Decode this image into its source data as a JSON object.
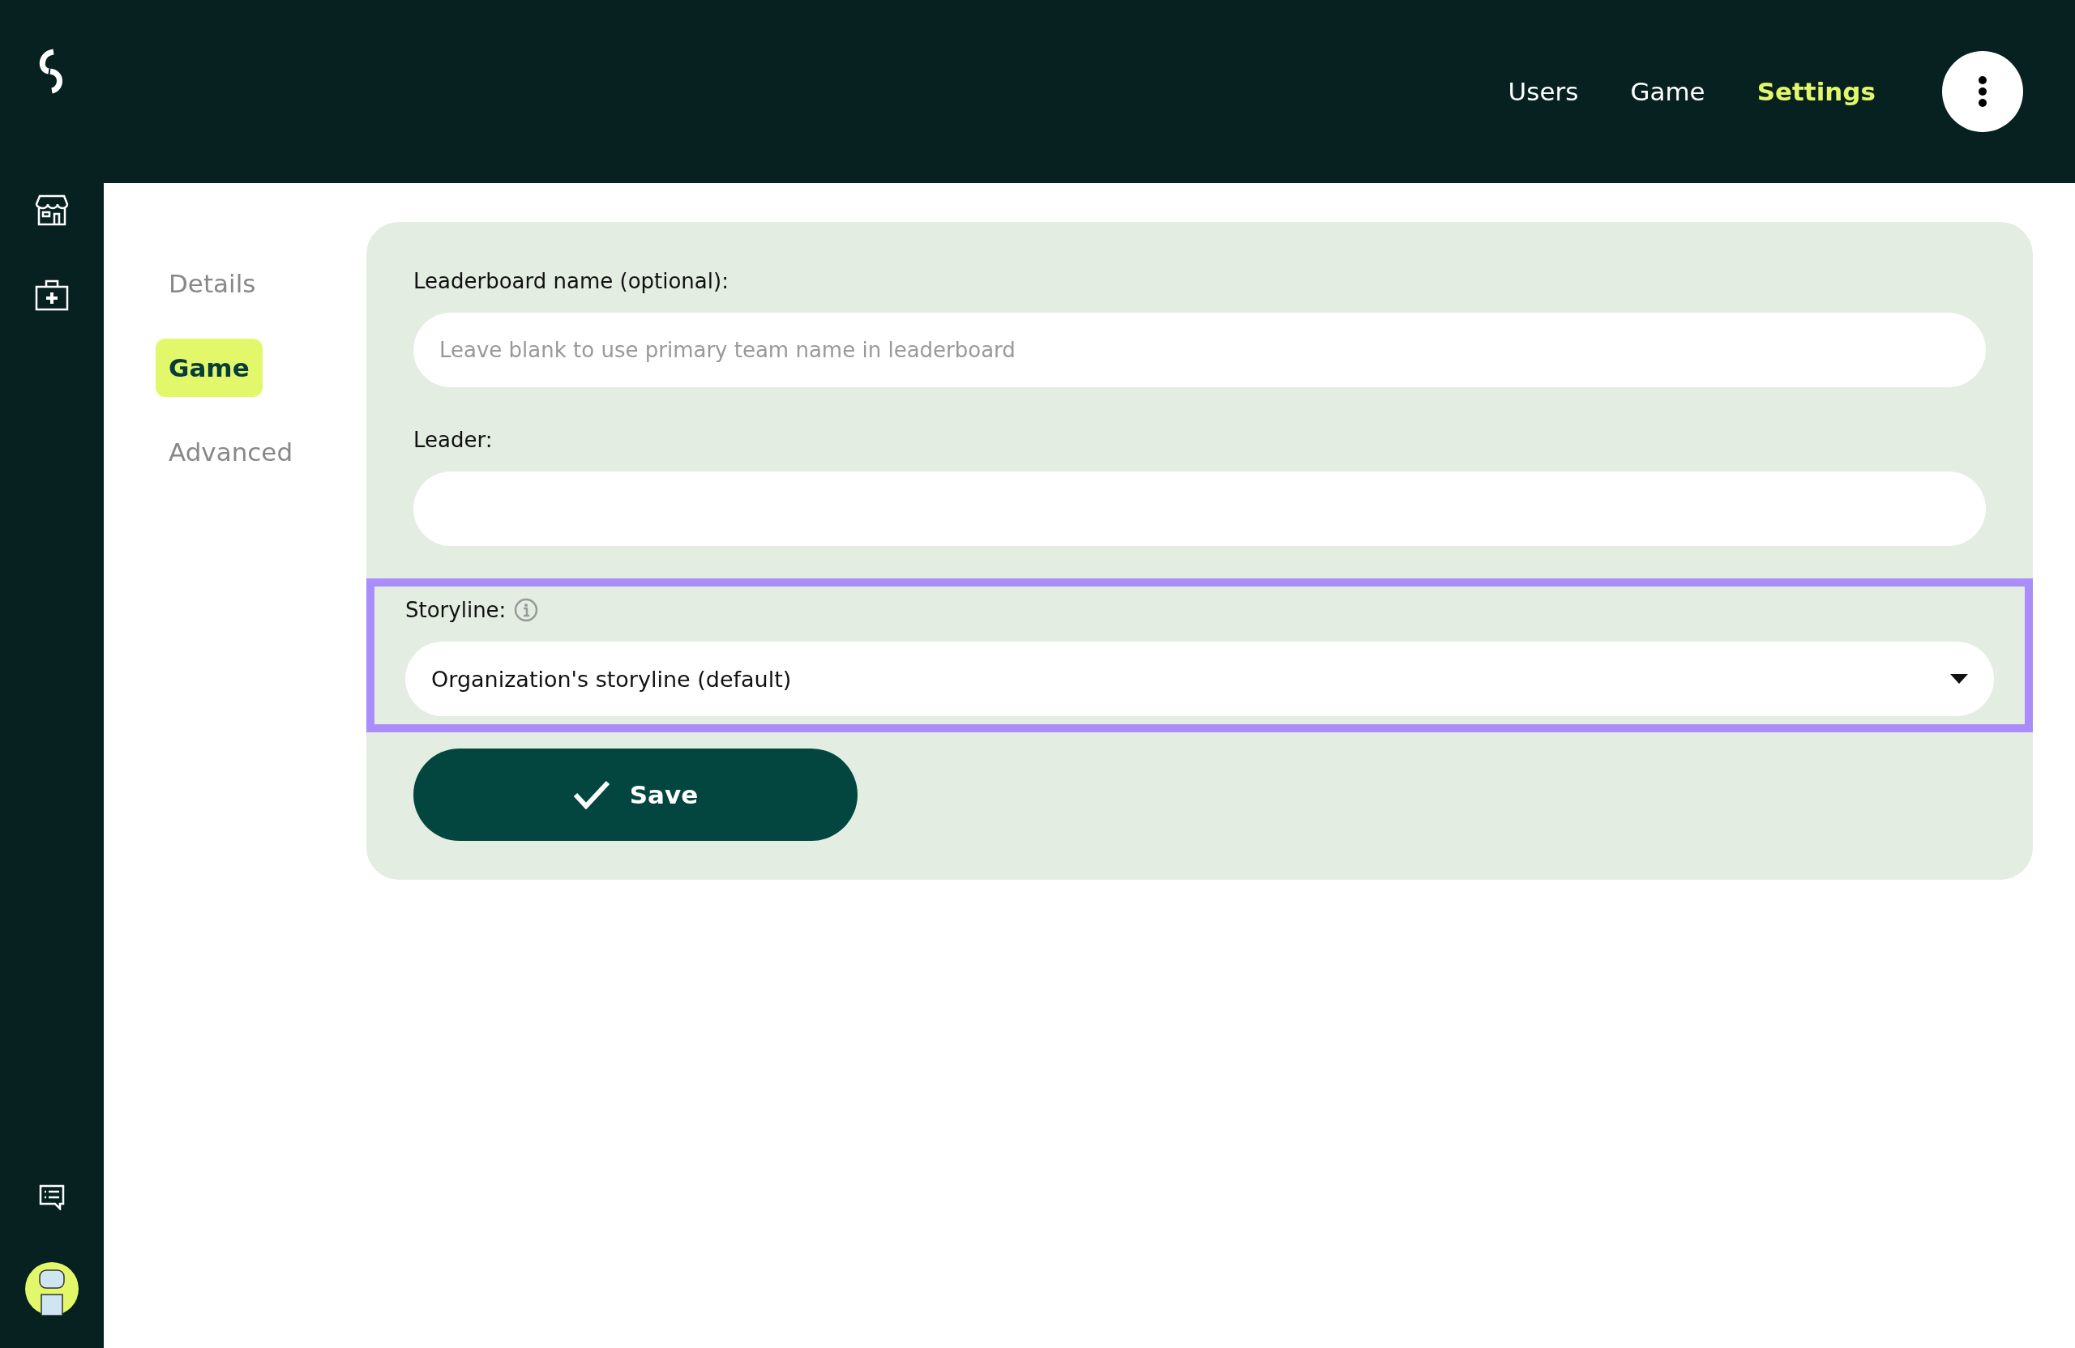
{
  "top_nav": [
    {
      "label": "Users",
      "selected": false
    },
    {
      "label": "Game",
      "selected": false
    },
    {
      "label": "Settings",
      "selected": true
    }
  ],
  "section_tabs": [
    {
      "label": "Details",
      "selected": false
    },
    {
      "label": "Game",
      "selected": true
    },
    {
      "label": "Advanced",
      "selected": false
    }
  ],
  "form": {
    "fields": [
      {
        "kind": "text",
        "label": "Leaderboard name (optional):",
        "placeholder": "Leave blank to use primary team name in leaderboard",
        "highlighted": false
      },
      {
        "kind": "text",
        "label": "Leader:",
        "highlighted": false
      },
      {
        "kind": "select",
        "label": "Storyline:",
        "info": true,
        "value": "Organization's storyline (default)",
        "highlighted": true
      }
    ],
    "save_button": "Save"
  }
}
